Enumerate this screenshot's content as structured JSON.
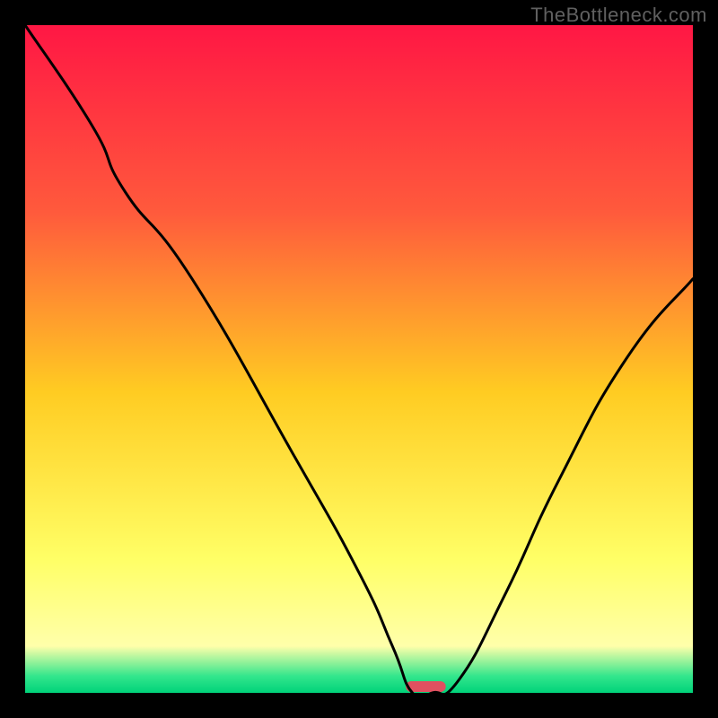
{
  "watermark": "TheBottleneck.com",
  "chart_data": {
    "type": "line",
    "title": "",
    "xlabel": "",
    "ylabel": "",
    "xlim": [
      0,
      100
    ],
    "ylim": [
      0,
      100
    ],
    "background_gradient_stops": [
      {
        "pos": 0.0,
        "color": "#ff1744"
      },
      {
        "pos": 0.28,
        "color": "#ff5a3c"
      },
      {
        "pos": 0.55,
        "color": "#ffcc22"
      },
      {
        "pos": 0.8,
        "color": "#ffff66"
      },
      {
        "pos": 0.93,
        "color": "#ffffaa"
      },
      {
        "pos": 0.975,
        "color": "#33e68c"
      },
      {
        "pos": 1.0,
        "color": "#00d27a"
      }
    ],
    "series": [
      {
        "name": "bottleneck-curve",
        "x": [
          0,
          10,
          15,
          25,
          40,
          50,
          55,
          58,
          61,
          65,
          72,
          80,
          90,
          100
        ],
        "y": [
          100,
          85,
          75,
          62,
          36,
          18,
          7,
          0,
          0,
          2,
          15,
          32,
          50,
          62
        ]
      }
    ],
    "marker": {
      "name": "optimal-range",
      "x_start": 57,
      "x_end": 63,
      "color": "#e05060"
    }
  }
}
